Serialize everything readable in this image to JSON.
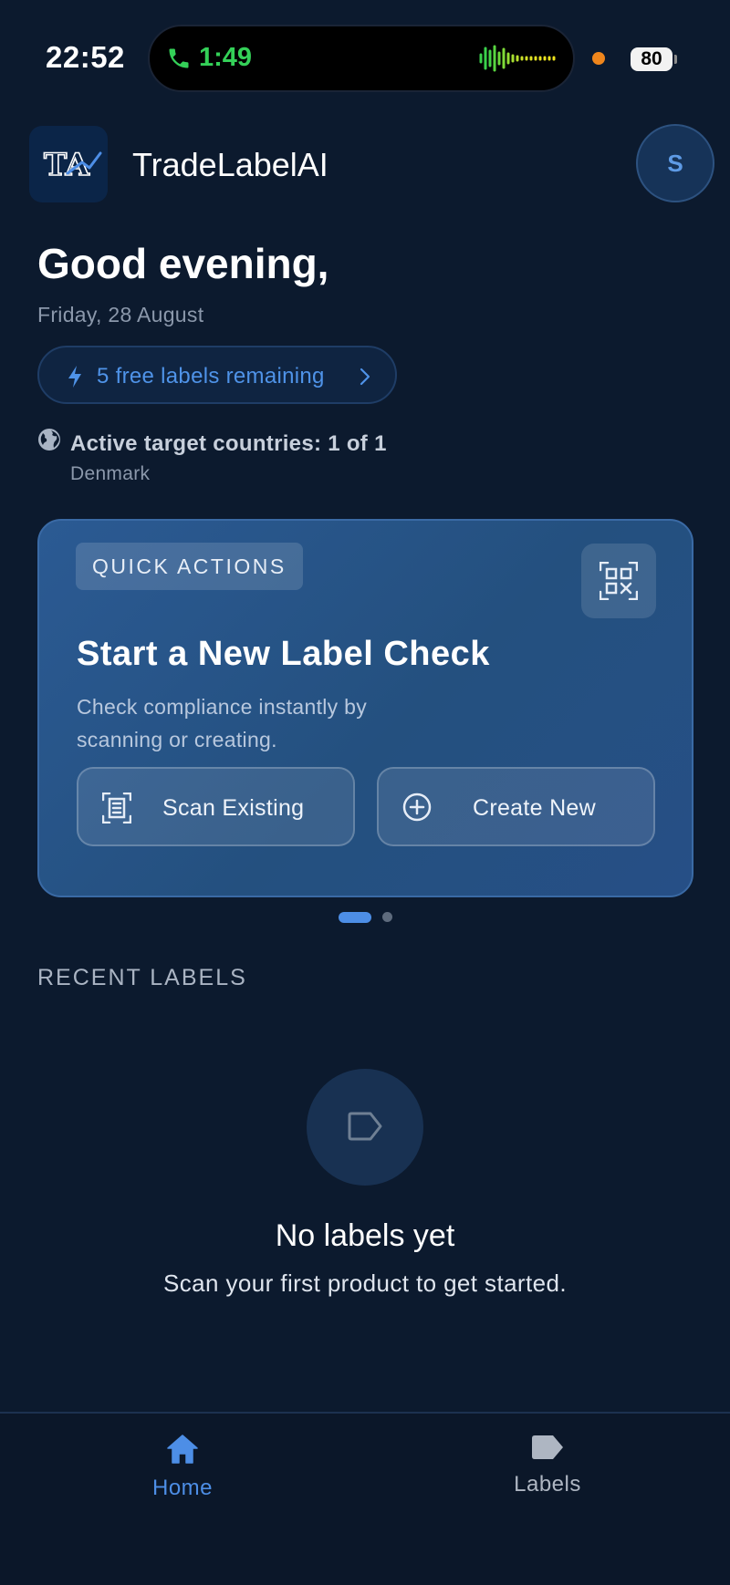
{
  "status_bar": {
    "time": "22:52",
    "call_timer": "1:49",
    "battery_level": "80",
    "colors": {
      "call": "#34d058",
      "recording": "#f0861c"
    }
  },
  "header": {
    "logo_text": "TA",
    "app_title": "TradeLabelAI",
    "avatar_initial": "S"
  },
  "greeting": {
    "title": "Good evening,",
    "date": "Friday, 28 August"
  },
  "free_labels": {
    "text": "5 free labels remaining",
    "icon": "lightning-icon"
  },
  "target_countries": {
    "text": "Active target countries: 1 of 1",
    "country": "Denmark",
    "icon": "globe-icon"
  },
  "quick_actions": {
    "badge": "QUICK ACTIONS",
    "title": "Start a New Label Check",
    "subtitle": "Check compliance instantly by scanning or creating.",
    "scan_button": "Scan Existing",
    "create_button": "Create New",
    "icons": [
      "qr-code-icon",
      "scan-frame-icon",
      "plus-circle-icon"
    ]
  },
  "carousel": {
    "pages": 2,
    "active_page": 1
  },
  "recent_labels": {
    "heading": "RECENT LABELS",
    "empty_title": "No labels yet",
    "empty_subtitle": "Scan your first product to get started."
  },
  "bottom_nav": {
    "items": [
      {
        "label": "Home",
        "icon": "home-icon",
        "active": true
      },
      {
        "label": "Labels",
        "icon": "tag-icon",
        "active": false
      }
    ]
  },
  "colors": {
    "background": "#0c1a2e",
    "accent": "#4d8ee6",
    "card": "#2b5a93"
  }
}
